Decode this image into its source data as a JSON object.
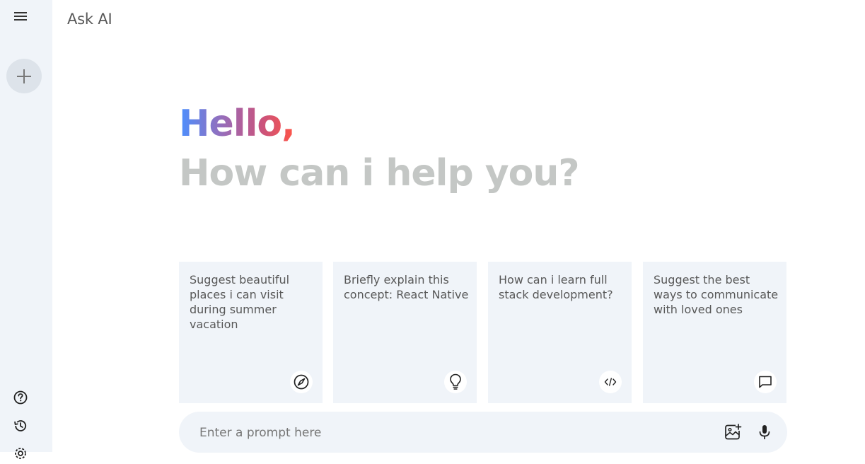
{
  "app": {
    "title": "Ask AI"
  },
  "sidebar": {
    "menu_icon": "menu-icon",
    "new_chat_icon": "plus-icon",
    "bottom_icons": [
      "help-icon",
      "history-icon",
      "settings-icon"
    ]
  },
  "greeting": {
    "hello": "Hello,",
    "subtitle": "How can i help you?",
    "gradient_colors": [
      "#4b90ff",
      "#9b6bb5",
      "#c7537f",
      "#ff5546"
    ]
  },
  "cards": [
    {
      "text": "Suggest beautiful places i can visit during summer vacation",
      "icon": "compass-icon"
    },
    {
      "text": "Briefly explain this concept: React Native",
      "icon": "lightbulb-icon"
    },
    {
      "text": "How can i learn full stack development?",
      "icon": "code-icon"
    },
    {
      "text": "Suggest the best ways to communicate with loved ones",
      "icon": "message-icon"
    }
  ],
  "prompt": {
    "placeholder": "Enter a prompt here",
    "icons": [
      "image-upload-icon",
      "microphone-icon"
    ]
  },
  "colors": {
    "sidebar_bg": "#f0f4f9",
    "card_bg": "#f0f4f9",
    "subtitle": "#c4c7c5"
  }
}
